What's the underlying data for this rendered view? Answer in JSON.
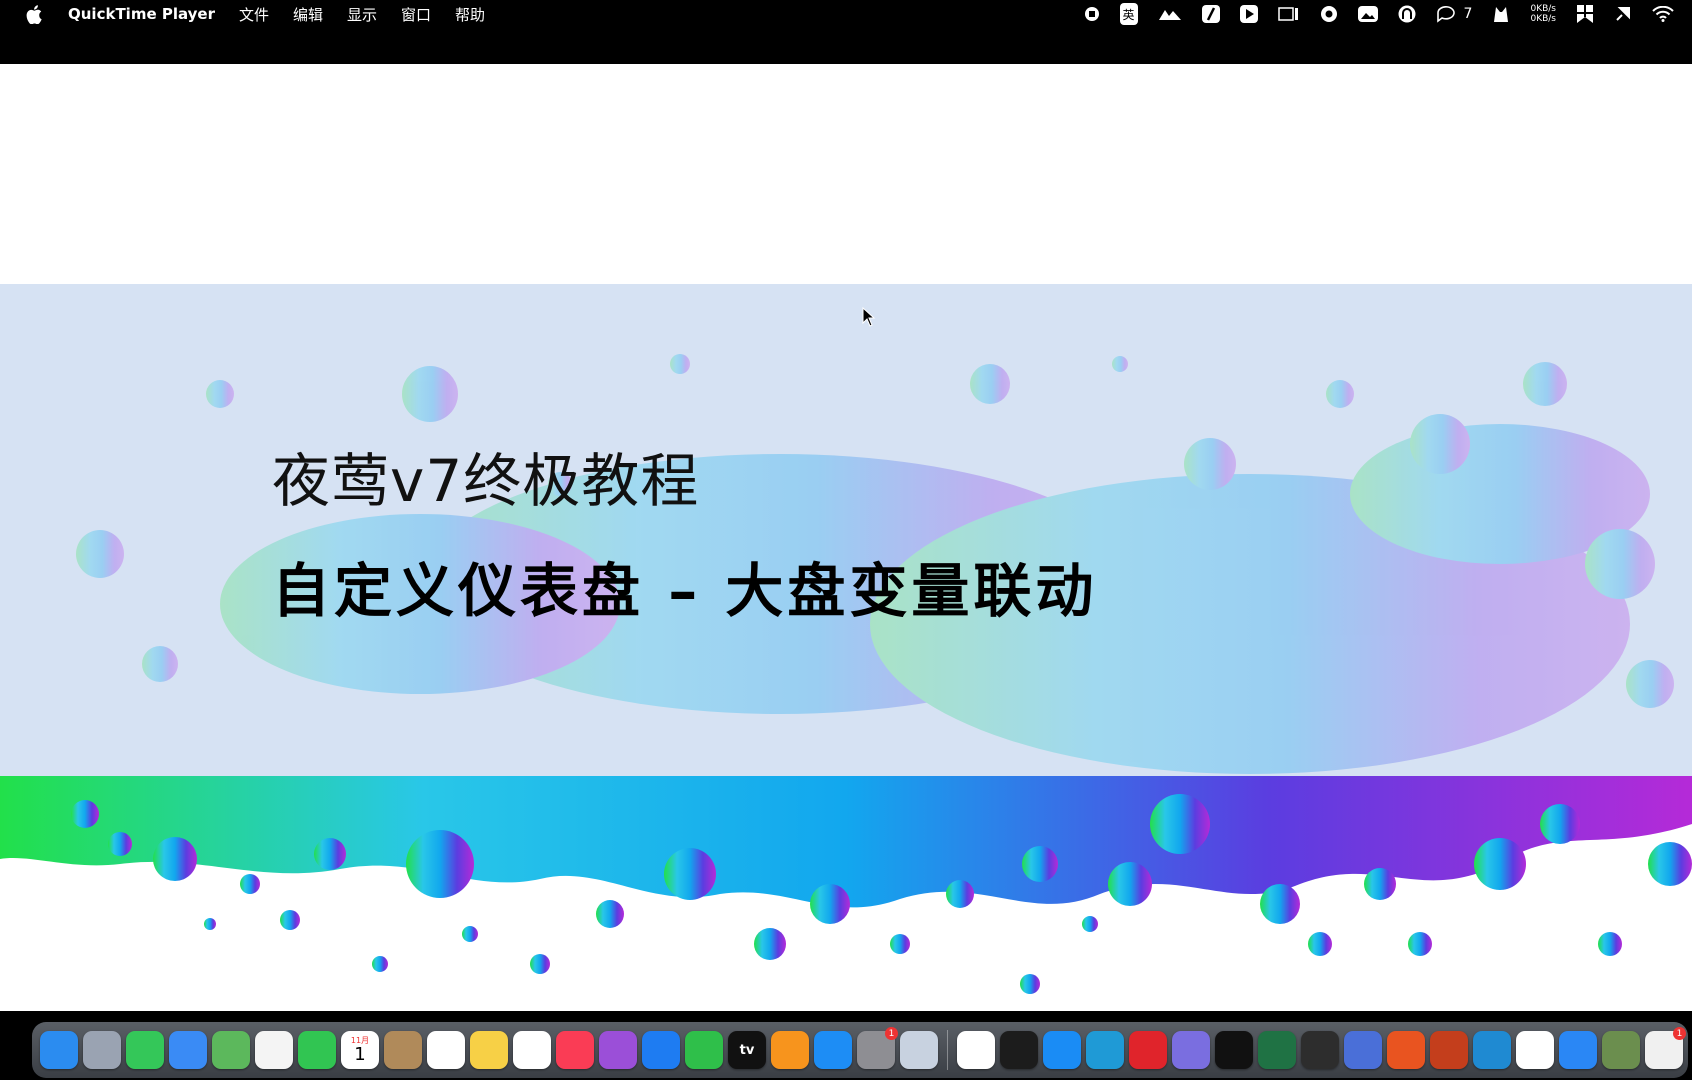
{
  "menubar": {
    "apple_icon": "apple-logo",
    "app_name": "QuickTime Player",
    "menus": [
      "文件",
      "编辑",
      "显示",
      "窗口",
      "帮助"
    ],
    "status": {
      "ime_label": "英",
      "notification_count": "7",
      "net_up": "0KB/s",
      "net_down": "0KB/s"
    }
  },
  "video": {
    "title_line1": "夜莺v7终极教程",
    "title_line2": "自定义仪表盘 – 大盘变量联动",
    "band_color": "#d6e2f3"
  },
  "dock": {
    "calendar_month": "11月",
    "calendar_day": "1",
    "tv_label": "tv",
    "settings_badge": "1",
    "last_badge": "1",
    "apps": [
      {
        "name": "finder",
        "color": "#2b8cf0"
      },
      {
        "name": "launchpad",
        "color": "#9aa3b2"
      },
      {
        "name": "messages",
        "color": "#34c759"
      },
      {
        "name": "mail",
        "color": "#3a8bf5"
      },
      {
        "name": "maps",
        "color": "#5cb85c"
      },
      {
        "name": "photos",
        "color": "#f4f4f4"
      },
      {
        "name": "facetime",
        "color": "#31c552"
      },
      {
        "name": "calendar",
        "color": "#ffffff"
      },
      {
        "name": "contacts",
        "color": "#b08a5a"
      },
      {
        "name": "reminders",
        "color": "#ffffff"
      },
      {
        "name": "notes",
        "color": "#f7d046"
      },
      {
        "name": "freeform",
        "color": "#ffffff"
      },
      {
        "name": "music",
        "color": "#fa3c55"
      },
      {
        "name": "podcasts",
        "color": "#9b4fd8"
      },
      {
        "name": "keynote",
        "color": "#1e7cf2"
      },
      {
        "name": "numbers",
        "color": "#2fbf4a"
      },
      {
        "name": "apple-tv",
        "color": "#111111"
      },
      {
        "name": "pages",
        "color": "#f7941d"
      },
      {
        "name": "app-store",
        "color": "#1d8df5"
      },
      {
        "name": "system-settings",
        "color": "#8e8e93"
      },
      {
        "name": "preview",
        "color": "#c8d2e0"
      },
      {
        "name": "chrome",
        "color": "#ffffff"
      },
      {
        "name": "terminal",
        "color": "#1c1c1c"
      },
      {
        "name": "safari",
        "color": "#1a8cf5"
      },
      {
        "name": "edge",
        "color": "#1f9ad6"
      },
      {
        "name": "netease-music",
        "color": "#e0242b"
      },
      {
        "name": "orb-app",
        "color": "#7a6ee0"
      },
      {
        "name": "green-app",
        "color": "#111111"
      },
      {
        "name": "excel",
        "color": "#1f7244"
      },
      {
        "name": "sublime-text",
        "color": "#2d2d2d"
      },
      {
        "name": "screen-app",
        "color": "#4a6fd8"
      },
      {
        "name": "ubuntu",
        "color": "#e95420"
      },
      {
        "name": "powerpoint",
        "color": "#c43e1c"
      },
      {
        "name": "vscode",
        "color": "#1f8ad2"
      },
      {
        "name": "chat-app",
        "color": "#ffffff"
      },
      {
        "name": "feishu",
        "color": "#2a87f5"
      },
      {
        "name": "utility-app",
        "color": "#6b8e4e"
      },
      {
        "name": "grid-app",
        "color": "#f0f0f0"
      }
    ]
  }
}
